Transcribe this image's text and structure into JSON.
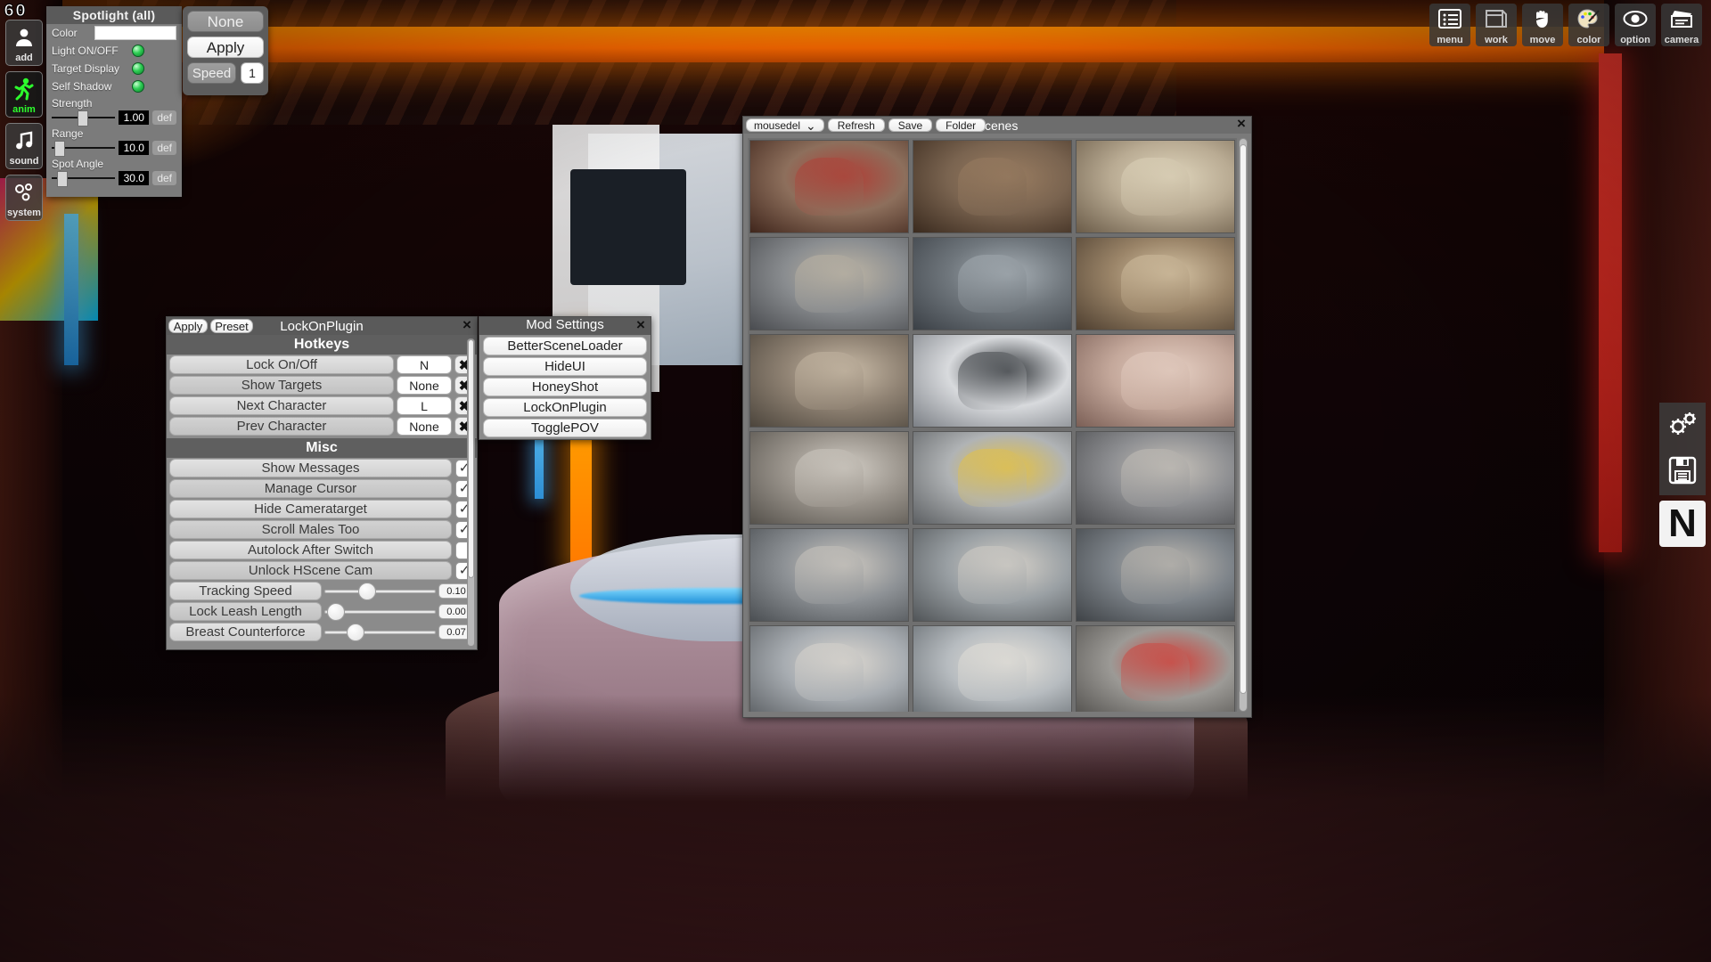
{
  "hud": {
    "fps": "60"
  },
  "left_rail": {
    "items": [
      {
        "label": "add",
        "icon": "add-character-icon"
      },
      {
        "label": "anim",
        "icon": "animation-running-icon"
      },
      {
        "label": "sound",
        "icon": "music-note-icon"
      },
      {
        "label": "system",
        "icon": "gears-icon"
      }
    ]
  },
  "spotlight": {
    "title": "Spotlight (all)",
    "color_label": "Color",
    "color_value": "#ffffff",
    "toggles": [
      {
        "label": "Light ON/OFF",
        "on": true
      },
      {
        "label": "Target Display",
        "on": true
      },
      {
        "label": "Self Shadow",
        "on": true
      }
    ],
    "sliders": [
      {
        "label": "Strength",
        "value": "1.00",
        "pos": 40,
        "default_label": "def"
      },
      {
        "label": "Range",
        "value": "10.0",
        "pos": 5,
        "default_label": "def"
      },
      {
        "label": "Spot Angle",
        "value": "30.0",
        "pos": 10,
        "default_label": "def"
      }
    ]
  },
  "anim_panel": {
    "none_label": "None",
    "apply_label": "Apply",
    "speed_label": "Speed",
    "speed_value": "1"
  },
  "toolbar": {
    "items": [
      {
        "label": "menu",
        "icon": "menu-list-icon"
      },
      {
        "label": "work",
        "icon": "workspace-window-icon"
      },
      {
        "label": "move",
        "icon": "hand-move-icon"
      },
      {
        "label": "color",
        "icon": "palette-icon"
      },
      {
        "label": "option",
        "icon": "eye-icon"
      },
      {
        "label": "camera",
        "icon": "clapperboard-icon"
      }
    ]
  },
  "side_buttons": {
    "items": [
      {
        "name": "settings-gears-button",
        "icon": "gears-icon",
        "label": ""
      },
      {
        "name": "save-button",
        "icon": "floppy-disk-icon",
        "label": ""
      },
      {
        "name": "n-button",
        "icon": "letter-n-icon",
        "label": "N"
      }
    ]
  },
  "lockon": {
    "title": "LockOnPlugin",
    "apply_label": "Apply",
    "preset_label": "Preset",
    "close_label": "×",
    "hotkeys_header": "Hotkeys",
    "hotkeys": [
      {
        "label": "Lock On/Off",
        "value": "N",
        "clear": "✖"
      },
      {
        "label": "Show Targets",
        "value": "None",
        "clear": "✖"
      },
      {
        "label": "Next Character",
        "value": "L",
        "clear": "✖"
      },
      {
        "label": "Prev Character",
        "value": "None",
        "clear": "✖"
      }
    ],
    "misc_header": "Misc",
    "misc_toggles": [
      {
        "label": "Show Messages",
        "checked": true
      },
      {
        "label": "Manage Cursor",
        "checked": true
      },
      {
        "label": "Hide Cameratarget",
        "checked": true
      },
      {
        "label": "Scroll Males Too",
        "checked": true
      },
      {
        "label": "Autolock After Switch",
        "checked": false
      },
      {
        "label": "Unlock HScene Cam",
        "checked": true
      }
    ],
    "misc_sliders": [
      {
        "label": "Tracking Speed",
        "value": "0.10",
        "pos": 30
      },
      {
        "label": "Lock Leash Length",
        "value": "0.00",
        "pos": 4
      },
      {
        "label": "Breast Counterforce",
        "value": "0.07",
        "pos": 22
      }
    ]
  },
  "mod_settings": {
    "title": "Mod Settings",
    "close_label": "×",
    "buttons": [
      "BetterSceneLoader",
      "HideUI",
      "HoneyShot",
      "LockOnPlugin",
      "TogglePOV"
    ]
  },
  "scenes": {
    "title": "Scenes",
    "close_label": "×",
    "dropdown_value": "mousedel",
    "dropdown_caret": "⌄",
    "buttons": [
      "Refresh",
      "Save",
      "Folder"
    ],
    "thumbnails": [
      {
        "id": 1,
        "alt": "library-red-couch-scene",
        "c1": "#8d6f5c",
        "c2": "#40261c",
        "c3": "#b23b33"
      },
      {
        "id": 2,
        "alt": "library-shelves-scene",
        "c1": "#7a6450",
        "c2": "#3a2a1e",
        "c3": "#9b7e62"
      },
      {
        "id": 3,
        "alt": "round-window-cats-scene",
        "c1": "#b9ab93",
        "c2": "#6b5c49",
        "c3": "#e0d6bd"
      },
      {
        "id": 4,
        "alt": "street-dog-rain-scene",
        "c1": "#8a8d90",
        "c2": "#4a4c50",
        "c3": "#c0b7a6"
      },
      {
        "id": 5,
        "alt": "rainy-street-car-scene",
        "c1": "#6f767c",
        "c2": "#3b4046",
        "c3": "#a8b0b6"
      },
      {
        "id": 6,
        "alt": "guitar-indoor-scene",
        "c1": "#9a8468",
        "c2": "#4e3f30",
        "c3": "#d6c4a5"
      },
      {
        "id": 7,
        "alt": "guitar-lying-scene",
        "c1": "#8f8273",
        "c2": "#4c453c",
        "c3": "#cbbda9"
      },
      {
        "id": 8,
        "alt": "guitar-white-room-scene",
        "c1": "#d8dadd",
        "c2": "#7c8086",
        "c3": "#2b2f33"
      },
      {
        "id": 9,
        "alt": "pool-flowers-scene",
        "c1": "#c4a89b",
        "c2": "#7b5f56",
        "c3": "#e6d0c4"
      },
      {
        "id": 10,
        "alt": "rubble-sitting-scene",
        "c1": "#9a948c",
        "c2": "#55514b",
        "c3": "#d3cec6"
      },
      {
        "id": 11,
        "alt": "yellow-car-street-scene",
        "c1": "#b0b3b5",
        "c2": "#5d6063",
        "c3": "#e8c23a"
      },
      {
        "id": 12,
        "alt": "window-lying-scene",
        "c1": "#8e8f92",
        "c2": "#4c4d50",
        "c3": "#c8c3bb"
      },
      {
        "id": 13,
        "alt": "street-two-figures-scene",
        "c1": "#8e9296",
        "c2": "#4b4f53",
        "c3": "#cfcac2"
      },
      {
        "id": 14,
        "alt": "street-dog-two-scene",
        "c1": "#9aa0a4",
        "c2": "#515558",
        "c3": "#d7d2ca"
      },
      {
        "id": 15,
        "alt": "city-night-scene",
        "c1": "#7e848a",
        "c2": "#3f4347",
        "c3": "#bfbab2"
      },
      {
        "id": 16,
        "alt": "snow-street-dog-scene",
        "c1": "#a8adb2",
        "c2": "#5b5f63",
        "c3": "#ded9d1"
      },
      {
        "id": 17,
        "alt": "fountain-plaza-scene",
        "c1": "#b7bcc0",
        "c2": "#646a6f",
        "c3": "#e6e2da"
      },
      {
        "id": 18,
        "alt": "umbrella-parasol-scene",
        "c1": "#9c9a96",
        "c2": "#514f4c",
        "c3": "#d43b34"
      }
    ]
  }
}
